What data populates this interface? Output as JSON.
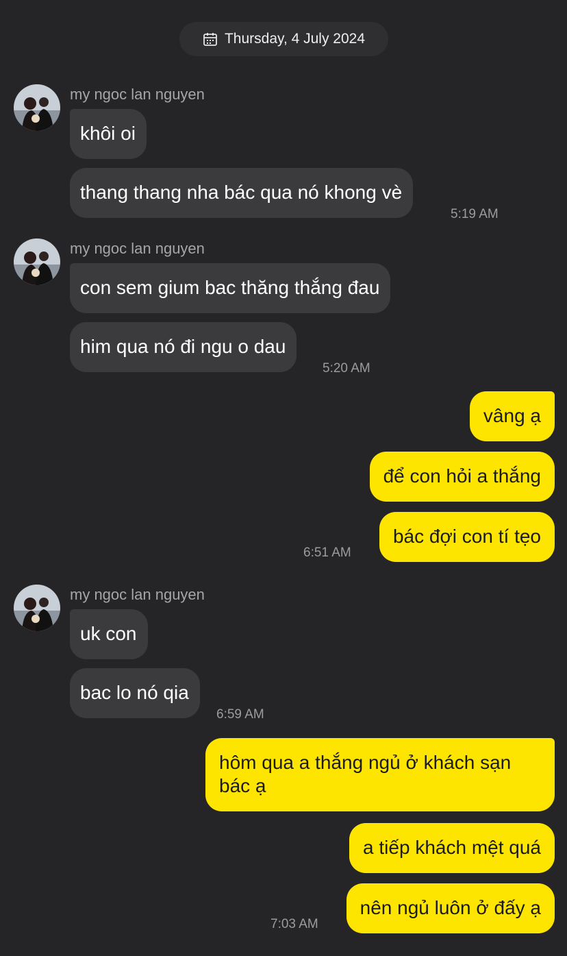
{
  "date_divider": {
    "label": "Thursday, 4 July 2024",
    "icon": "calendar-icon"
  },
  "groups": [
    {
      "sender": "my ngoc lan nguyen",
      "messages": [
        "khôi oi",
        "thang thang nha bác qua nó khong vè"
      ],
      "time": "5:19 AM"
    },
    {
      "sender": "my ngoc lan nguyen",
      "messages": [
        "con sem gium bac thăng thắng đau",
        "him qua nó đi ngu o dau"
      ],
      "time": "5:20 AM"
    },
    {
      "sender": "me",
      "messages": [
        "vâng ạ",
        "để con hỏi a thắng",
        "bác đợi con tí tẹo"
      ],
      "time": "6:51 AM"
    },
    {
      "sender": "my ngoc lan nguyen",
      "messages": [
        "uk con",
        "bac lo nó qia"
      ],
      "time": "6:59 AM"
    },
    {
      "sender": "me",
      "messages": [
        "hôm qua a thắng ngủ ở khách sạn bác ạ",
        "a tiếp khách mệt quá",
        "nên ngủ luôn ở đấy ạ"
      ],
      "time": "7:03 AM"
    }
  ],
  "colors": {
    "background": "#252527",
    "incoming_bubble": "#3b3b3d",
    "outgoing_bubble": "#fee500"
  }
}
